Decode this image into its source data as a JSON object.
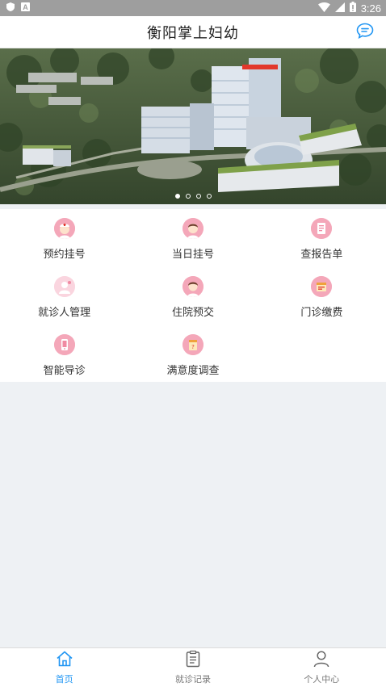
{
  "status_bar": {
    "time": "3:26",
    "left_icons": [
      "shield-icon",
      "a-icon"
    ],
    "right_icons": [
      "wifi-icon",
      "signal-icon",
      "battery-icon"
    ]
  },
  "header": {
    "title": "衡阳掌上妇幼",
    "message_icon": "chat-bubble-icon",
    "accent": "#2196f3"
  },
  "banner": {
    "image": "hospital-campus-aerial-photo",
    "slide_count": 4,
    "active_slide": 1
  },
  "menu": {
    "items": [
      {
        "label": "预约挂号",
        "icon": "nurse-icon"
      },
      {
        "label": "当日挂号",
        "icon": "doctor-icon"
      },
      {
        "label": "查报告单",
        "icon": "report-icon"
      },
      {
        "label": "就诊人管理",
        "icon": "patient-icon"
      },
      {
        "label": "住院预交",
        "icon": "inpatient-icon"
      },
      {
        "label": "门诊缴费",
        "icon": "payment-icon"
      },
      {
        "label": "智能导诊",
        "icon": "guide-icon"
      },
      {
        "label": "满意度调查",
        "icon": "survey-icon"
      }
    ]
  },
  "tabbar": {
    "tabs": [
      {
        "label": "首页",
        "icon": "home-icon",
        "active": true
      },
      {
        "label": "就诊记录",
        "icon": "clipboard-icon",
        "active": false
      },
      {
        "label": "个人中心",
        "icon": "person-icon",
        "active": false
      }
    ],
    "active_color": "#2196f3",
    "inactive_color": "#777777"
  }
}
